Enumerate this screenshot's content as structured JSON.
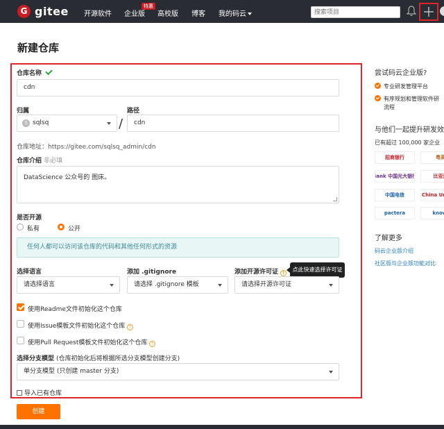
{
  "nav": {
    "logo_letter": "G",
    "logo_text": "gitee",
    "items": [
      "开源软件",
      "企业版",
      "高校版",
      "博客",
      "我的码云"
    ],
    "hot_badge": "特惠",
    "search_placeholder": "搜索项目"
  },
  "page_title": "新建仓库",
  "form": {
    "repo_name_label": "仓库名称",
    "repo_name_value": "cdn",
    "owner_label": "归属",
    "owner_value": "sqlsq",
    "owner_avatar_letter": "S",
    "path_label": "路径",
    "path_value": "cdn",
    "address_text": "仓库地址：https://gitee.com/sqlsq_admin/cdn",
    "desc_label": "仓库介绍",
    "desc_optional": "非必填",
    "desc_value": "DataScience 公众号的 图床。",
    "open_source_label": "是否开源",
    "private_label": "私有",
    "public_label": "公开",
    "public_info": "任何人都可以访问该仓库的代码和其他任何形式的资源",
    "language_label": "选择语言",
    "language_placeholder": "请选择语言",
    "gitignore_label": "添加 .gitignore",
    "gitignore_placeholder": "请选择 .gitignore 模板",
    "license_label": "添加开源许可证",
    "license_placeholder": "请选择开源许可证",
    "license_tooltip": "点此快速选择许可证",
    "cb_readme": "使用Readme文件初始化这个仓库",
    "cb_issue": "使用Issue模板文件初始化这个仓库",
    "cb_pr": "使用Pull Request模板文件初始化这个仓库",
    "branch_label": "选择分支模型",
    "branch_hint": "(仓库初始化后将根据所选分支模型创建分支)",
    "branch_value": "单分支模型 (只创建 master 分支)",
    "import_link": "导入已有仓库",
    "create_button": "创建"
  },
  "sidebar": {
    "title": "尝试码云企业版?",
    "features": [
      "专业研发管理平台",
      "有序规划和管理软件研",
      "流程"
    ],
    "section2_title": "与他们一起提升研发效",
    "stats": "已有超过 100,000 家企业",
    "logos": [
      "招商银行",
      "粤高",
      "Bank 中国光大银行",
      "比亚迪",
      "中国电信",
      "China Unicom",
      "pactera",
      "knowl"
    ],
    "learn_more": "了解更多",
    "link1": "码云企业版介绍",
    "link2": "社区版与企业版功能对比"
  },
  "colors": {
    "accent": "#fe7300",
    "brand_red": "#c71d23",
    "nav_bg": "#292c33",
    "highlight_frame": "#e0242b"
  }
}
